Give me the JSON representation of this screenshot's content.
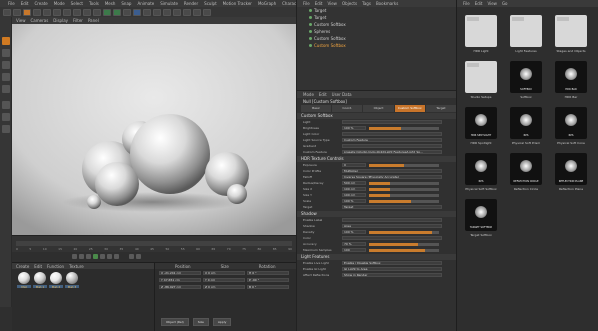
{
  "menubar": {
    "items": [
      "File",
      "Edit",
      "Create",
      "Mode",
      "Select",
      "Tools",
      "Mesh",
      "Snap",
      "Animate",
      "Simulate",
      "Render",
      "Sculpt",
      "Motion Tracker",
      "MoGraph",
      "Character",
      "Pipeline",
      "Plugins",
      "Script",
      "Window",
      "Help"
    ]
  },
  "viewport": {
    "menu": [
      "View",
      "Cameras",
      "Display",
      "Filter",
      "Panel"
    ]
  },
  "timeline": {
    "ticks": [
      "0",
      "5",
      "10",
      "15",
      "20",
      "25",
      "30",
      "35",
      "40",
      "45",
      "50",
      "55",
      "60",
      "65",
      "70",
      "75",
      "80",
      "85",
      "90"
    ]
  },
  "materials": {
    "menu": [
      "Create",
      "Edit",
      "Function",
      "Texture"
    ],
    "items": [
      {
        "label": "Mat",
        "color": "#dcdcdc"
      },
      {
        "label": "Mat.1",
        "color": "#cfcfcf"
      },
      {
        "label": "Mat.2",
        "color": "#e8e8e8"
      },
      {
        "label": "Mat.3",
        "color": "#bdbdbd"
      }
    ]
  },
  "coords": {
    "head": [
      "Position",
      "Size",
      "Rotation"
    ],
    "rows": [
      {
        "pos": "X  -21.241 cm",
        "size": "X  0 cm",
        "rot": "H  0 °"
      },
      {
        "pos": "Y  47.651 cm",
        "size": "Y  0 cm",
        "rot": "P  -90 °"
      },
      {
        "pos": "Z  -86.927 cm",
        "size": "Z  0 cm",
        "rot": "B  0 °"
      }
    ],
    "buttons": [
      "Object (Rel)",
      "Size",
      "Apply"
    ]
  },
  "objects": {
    "menu": [
      "File",
      "Edit",
      "View",
      "Objects",
      "Tags",
      "Bookmarks"
    ],
    "items": [
      {
        "name": "Target",
        "selected": false
      },
      {
        "name": "Target",
        "selected": false
      },
      {
        "name": "Custom Softbox",
        "selected": false
      },
      {
        "name": "Spheres",
        "selected": false
      },
      {
        "name": "Custom Softbox",
        "selected": false
      },
      {
        "name": "Custom Softbox",
        "selected": true
      }
    ]
  },
  "attributes": {
    "menu": [
      "Mode",
      "Edit",
      "User Data"
    ],
    "title": "Null [Custom Softbox]",
    "tabs": [
      "Basic",
      "Coord.",
      "Object",
      "Custom Softbox",
      "Target"
    ],
    "active_tab": "Custom Softbox",
    "section1": "Custom Softbox",
    "section2": "HDR Texture Controls",
    "section3": "Shadow",
    "section4": "Light Features",
    "props": [
      {
        "label": "Light",
        "value": ""
      },
      {
        "label": "Brightness",
        "value": "100 %",
        "fill": 0.45
      },
      {
        "label": "Light Color",
        "value": ""
      },
      {
        "label": "Light Source Type",
        "value": "Custom Feature"
      },
      {
        "label": "Gradient",
        "value": ""
      },
      {
        "label": "Custom Feature",
        "value": "presets://studio-tools.lib4d/Light Features/Light_Sp..."
      },
      {
        "label": "Exposure",
        "value": "0",
        "fill": 0.5
      },
      {
        "label": "Color Profile",
        "value": "Multiplier"
      },
      {
        "label": "Falloff",
        "value": "Inverse Square (Physically Accurate)"
      },
      {
        "label": "Radius/Decay",
        "value": "500 cm",
        "fill": 0.3
      },
      {
        "label": "Size X",
        "value": "100 cm",
        "fill": 0.3
      },
      {
        "label": "Size Y",
        "value": "100 cm",
        "fill": 0.3
      },
      {
        "label": "Scale",
        "value": "100 %",
        "fill": 0.6
      },
      {
        "label": "Target",
        "value": "Target"
      },
      {
        "label": "Enable Label",
        "value": ""
      },
      {
        "label": "Shadow",
        "value": "Area"
      },
      {
        "label": "Density",
        "value": "100 %",
        "fill": 0.9
      },
      {
        "label": "Color",
        "value": ""
      },
      {
        "label": "Accuracy",
        "value": "70 %",
        "fill": 0.7
      },
      {
        "label": "Maximum Samples",
        "value": "100",
        "fill": 0.8
      },
      {
        "label": "Enable Live Light",
        "value": "Enable / Disable Softbox"
      },
      {
        "label": "Enable GI Light",
        "value": "GI Light to Area"
      },
      {
        "label": "Affect Reflections",
        "value": "Show in Render"
      }
    ]
  },
  "content": {
    "menu": [
      "File",
      "Edit",
      "View",
      "Go"
    ],
    "items": [
      {
        "label": "HDR Light",
        "kind": "folder"
      },
      {
        "label": "Light Features",
        "kind": "folder"
      },
      {
        "label": "Stages and Objects",
        "kind": "folder"
      },
      {
        "label": "Studio Setups",
        "kind": "folder"
      },
      {
        "label": "SOFTBOX",
        "caption": "Softbox",
        "kind": "dark"
      },
      {
        "label": "HDR BAR",
        "caption": "HDR Bar",
        "kind": "dark"
      },
      {
        "label": "HDR SPOTLIGHT",
        "caption": "HDR Spotlight",
        "kind": "dark"
      },
      {
        "label": "RPS",
        "caption": "Physical Soft Prism",
        "kind": "dark"
      },
      {
        "label": "RPS",
        "caption": "Physical Soft Cone",
        "kind": "dark"
      },
      {
        "label": "RPS",
        "caption": "Physical Soft Softbox",
        "kind": "dark"
      },
      {
        "label": "REFLECTION CIRCLE",
        "caption": "Reflection Circle",
        "kind": "dark"
      },
      {
        "label": "REFLECTION PLANE",
        "caption": "Reflection Plane",
        "kind": "dark"
      },
      {
        "label": "TARGET SOFTBOX",
        "caption": "Target Softbox",
        "kind": "dark"
      }
    ]
  },
  "colors": {
    "accent": "#c8742a",
    "background": "#2f2f2f"
  }
}
